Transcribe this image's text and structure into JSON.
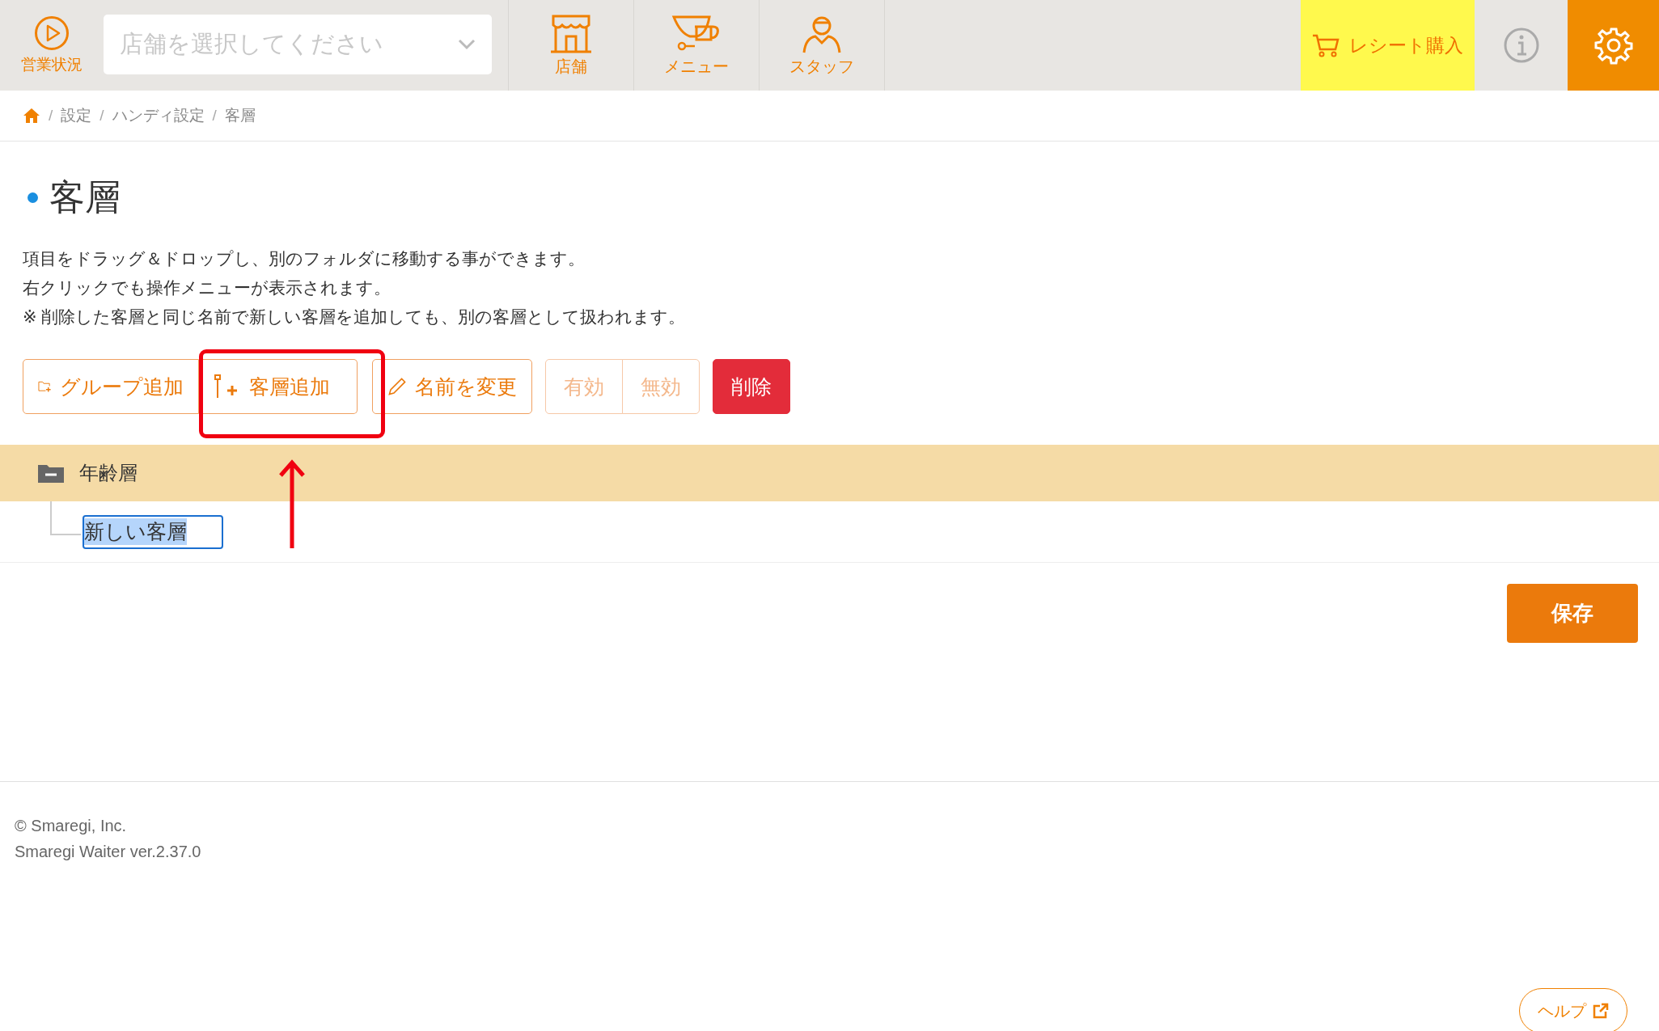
{
  "header": {
    "status_label": "営業状況",
    "store_select": {
      "placeholder": "店舗を選択してください"
    },
    "nav": [
      {
        "label": "店舗"
      },
      {
        "label": "メニュー"
      },
      {
        "label": "スタッフ"
      }
    ],
    "receipt_button": "レシート購入"
  },
  "breadcrumb": [
    {
      "separator": "/",
      "label": "設定"
    },
    {
      "separator": "/",
      "label": "ハンディ設定"
    },
    {
      "separator": "/",
      "label": "客層"
    }
  ],
  "page_title": "客層",
  "description": [
    "項目をドラッグ＆ドロップし、別のフォルダに移動する事ができます。",
    "右クリックでも操作メニューが表示されます。",
    "※ 削除した客層と同じ名前で新しい客層を追加しても、別の客層として扱われます。"
  ],
  "toolbar": [
    {
      "label": "グループ追加",
      "kind": "outline",
      "disabled": false
    },
    {
      "label": "客層追加",
      "kind": "outline",
      "disabled": false
    },
    {
      "label": "名前を変更",
      "kind": "outline",
      "disabled": false
    },
    {
      "label": "有効",
      "kind": "toggle",
      "disabled": true
    },
    {
      "label": "無効",
      "kind": "toggle",
      "disabled": true
    },
    {
      "label": "削除",
      "kind": "danger",
      "disabled": false
    }
  ],
  "tree": [
    {
      "label": "年齢層",
      "expanded": true,
      "selected": true,
      "children": [
        {
          "label": "新しい客層",
          "editing": true
        }
      ]
    }
  ],
  "save_button": "保存",
  "footer": [
    "© Smaregi, Inc.",
    "Smaregi Waiter ver.2.37.0"
  ],
  "help_button": "ヘルプ"
}
